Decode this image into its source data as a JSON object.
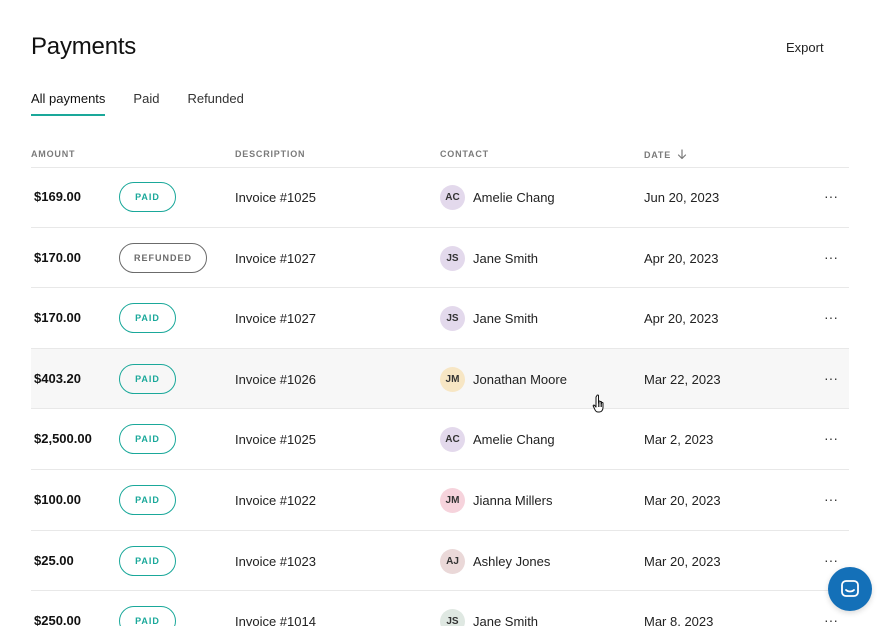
{
  "page": {
    "title": "Payments",
    "export_label": "Export"
  },
  "tabs": [
    {
      "label": "All payments",
      "active": true
    },
    {
      "label": "Paid",
      "active": false
    },
    {
      "label": "Refunded",
      "active": false
    }
  ],
  "table": {
    "columns": {
      "amount": "AMOUNT",
      "description": "DESCRIPTION",
      "contact": "CONTACT",
      "date": "DATE"
    },
    "rows": [
      {
        "amount": "$169.00",
        "status": "PAID",
        "description": "Invoice #1025",
        "initials": "AC",
        "contact": "Amelie Chang",
        "avatar_color": "#e3d9ec",
        "date": "Jun 20, 2023",
        "more": "···"
      },
      {
        "amount": "$170.00",
        "status": "REFUNDED",
        "description": "Invoice #1027",
        "initials": "JS",
        "contact": "Jane Smith",
        "avatar_color": "#e3d9ec",
        "date": "Apr 20, 2023",
        "more": "···"
      },
      {
        "amount": "$170.00",
        "status": "PAID",
        "description": "Invoice #1027",
        "initials": "JS",
        "contact": "Jane Smith",
        "avatar_color": "#e3d9ec",
        "date": "Apr 20, 2023",
        "more": "···"
      },
      {
        "amount": "$403.20",
        "status": "PAID",
        "description": "Invoice #1026",
        "initials": "JM",
        "contact": "Jonathan Moore",
        "avatar_color": "#f7e6c4",
        "date": "Mar 22, 2023",
        "more": "···"
      },
      {
        "amount": "$2,500.00",
        "status": "PAID",
        "description": "Invoice #1025",
        "initials": "AC",
        "contact": "Amelie Chang",
        "avatar_color": "#e3d9ec",
        "date": "Mar 2, 2023",
        "more": "···"
      },
      {
        "amount": "$100.00",
        "status": "PAID",
        "description": "Invoice #1022",
        "initials": "JM",
        "contact": "Jianna Millers",
        "avatar_color": "#f6d3dc",
        "date": "Mar 20, 2023",
        "more": "···"
      },
      {
        "amount": "$25.00",
        "status": "PAID",
        "description": "Invoice #1023",
        "initials": "AJ",
        "contact": "Ashley Jones",
        "avatar_color": "#ead8d8",
        "date": "Mar 20, 2023",
        "more": "···"
      },
      {
        "amount": "$250.00",
        "status": "PAID",
        "description": "Invoice #1014",
        "initials": "JS",
        "contact": "Jane Smith",
        "avatar_color": "#dfe8e2",
        "date": "Mar 8, 2023",
        "more": "···"
      }
    ]
  },
  "colors": {
    "accent": "#1aa89a",
    "refunded": "#6b6b6b",
    "chat_button": "#1470b8",
    "hover_row": "#f7f7f7"
  },
  "icons": {
    "sort": "arrow-down-icon",
    "more": "more-horizontal-icon",
    "chat": "chat-icon",
    "cursor": "hand-pointer-icon"
  }
}
